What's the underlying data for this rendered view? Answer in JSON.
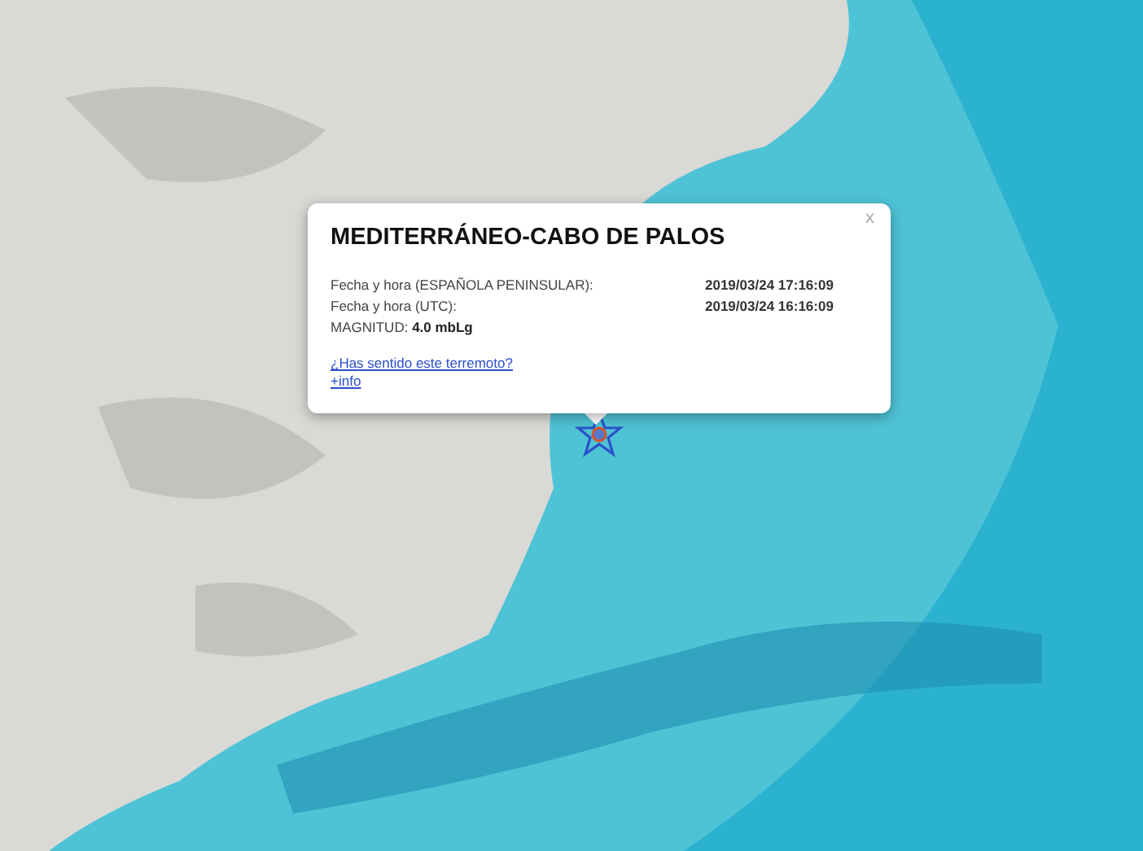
{
  "popup": {
    "title": "MEDITERRÁNEO-CABO DE PALOS",
    "close": "x",
    "rows": [
      {
        "label": "Fecha y hora (ESPAÑOLA PENINSULAR):",
        "value": "2019/03/24 17:16:09"
      },
      {
        "label": "Fecha y hora (UTC):",
        "value": "2019/03/24 16:16:09"
      }
    ],
    "magnitude": "MAGNITUD: **4.0 mbLg**",
    "links": [
      "¿Has sentido este terremoto?",
      "+info"
    ]
  }
}
